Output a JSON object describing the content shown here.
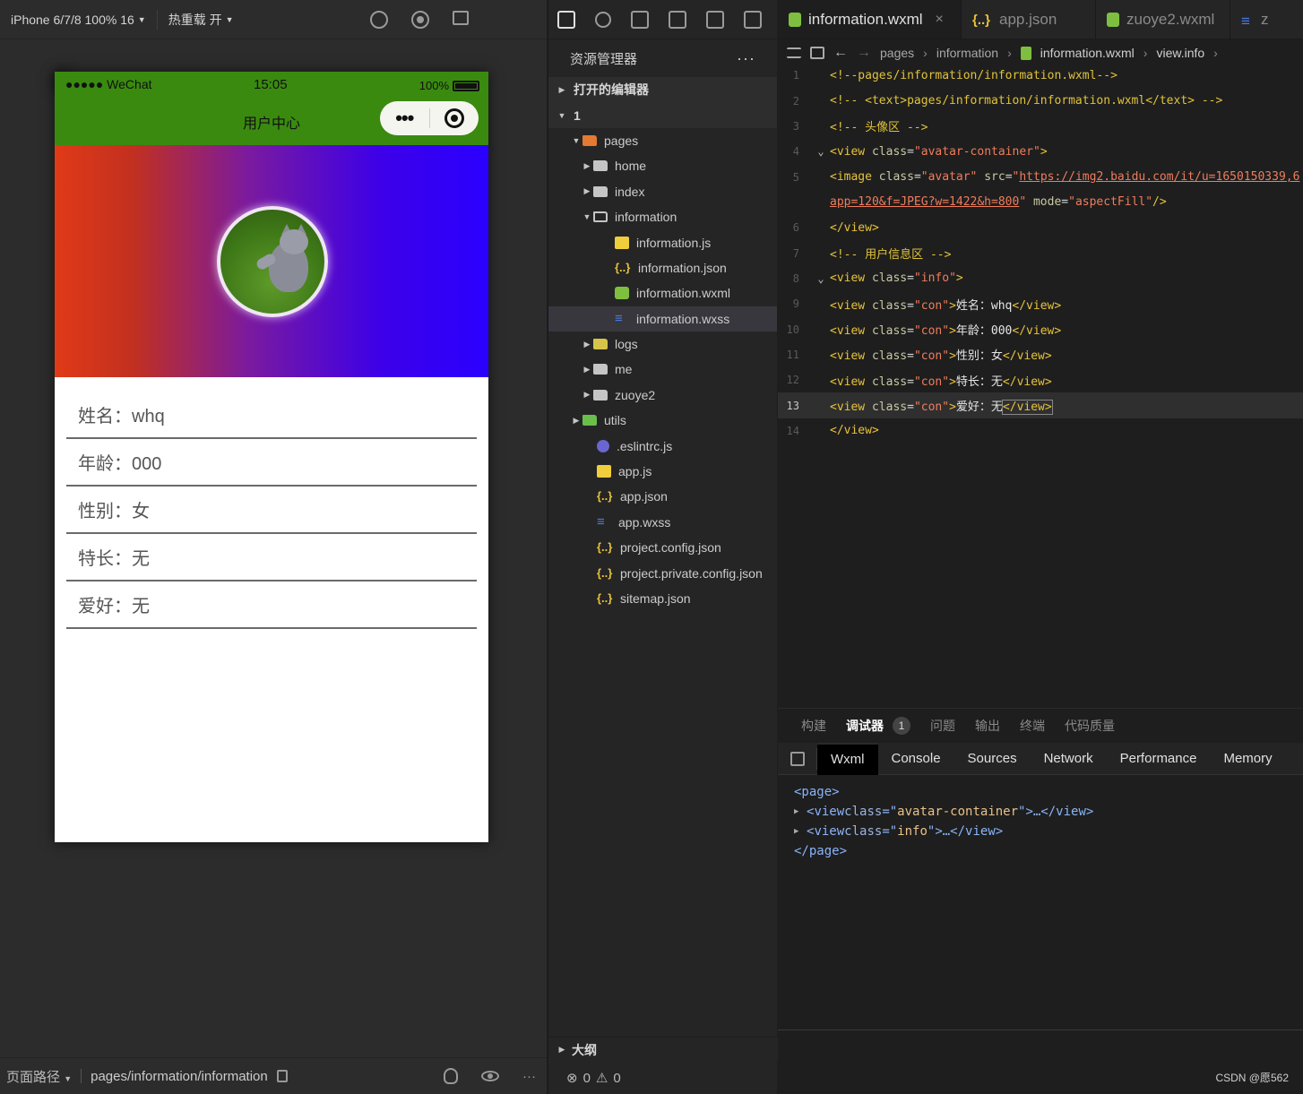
{
  "simulator": {
    "device_label": "iPhone 6/7/8 100% 16",
    "hot_reload_label": "热重载 开",
    "phone": {
      "carrier": "●●●●● WeChat",
      "time": "15:05",
      "battery": "100%",
      "nav_title": "用户中心",
      "capsule_more": "•••",
      "info_rows": [
        "姓名：whq",
        "年龄：000",
        "性别：女",
        "特长：无",
        "爱好：无"
      ]
    },
    "footer": {
      "path_label": "页面路径",
      "path_value": "pages/information/information",
      "more": "···"
    }
  },
  "explorer": {
    "title": "资源管理器",
    "more": "···",
    "tree": [
      {
        "label": "打开的编辑器",
        "type": "section",
        "arrow": "▶",
        "indent": 8
      },
      {
        "label": "1",
        "type": "section",
        "arrow": "▼",
        "indent": 8
      },
      {
        "label": "pages",
        "type": "folder-pages",
        "arrow": "▼",
        "indent": 24
      },
      {
        "label": "home",
        "type": "folder",
        "arrow": "▶",
        "indent": 36
      },
      {
        "label": "index",
        "type": "folder",
        "arrow": "▶",
        "indent": 36
      },
      {
        "label": "information",
        "type": "folder-open",
        "arrow": "▼",
        "indent": 36
      },
      {
        "label": "information.js",
        "type": "js",
        "arrow": "",
        "indent": 60
      },
      {
        "label": "information.json",
        "type": "json",
        "arrow": "",
        "indent": 60
      },
      {
        "label": "information.wxml",
        "type": "wxml",
        "arrow": "",
        "indent": 60
      },
      {
        "label": "information.wxss",
        "type": "wxss",
        "arrow": "",
        "indent": 60,
        "selected": true
      },
      {
        "label": "logs",
        "type": "folder-logs",
        "arrow": "▶",
        "indent": 36
      },
      {
        "label": "me",
        "type": "folder",
        "arrow": "▶",
        "indent": 36
      },
      {
        "label": "zuoye2",
        "type": "folder",
        "arrow": "▶",
        "indent": 36
      },
      {
        "label": "utils",
        "type": "folder-utils",
        "arrow": "▶",
        "indent": 24
      },
      {
        "label": ".eslintrc.js",
        "type": "eslint",
        "arrow": "",
        "indent": 40
      },
      {
        "label": "app.js",
        "type": "js",
        "arrow": "",
        "indent": 40
      },
      {
        "label": "app.json",
        "type": "json",
        "arrow": "",
        "indent": 40
      },
      {
        "label": "app.wxss",
        "type": "wxss",
        "arrow": "",
        "indent": 40
      },
      {
        "label": "project.config.json",
        "type": "json",
        "arrow": "",
        "indent": 40
      },
      {
        "label": "project.private.config.json",
        "type": "json",
        "arrow": "",
        "indent": 40
      },
      {
        "label": "sitemap.json",
        "type": "json",
        "arrow": "",
        "indent": 40
      }
    ],
    "outline_label": "大纲",
    "status_errors": "0",
    "status_warnings": "0"
  },
  "editor": {
    "tabs": [
      {
        "label": "information.wxml",
        "icon": "wxml",
        "active": true
      },
      {
        "label": "app.json",
        "icon": "json",
        "active": false
      },
      {
        "label": "zuoye2.wxml",
        "icon": "wxml",
        "active": false
      },
      {
        "label": "z",
        "icon": "wxss",
        "active": false
      }
    ],
    "breadcrumb": [
      "pages",
      "information",
      "information.wxml",
      "view.info"
    ],
    "current_line": 13,
    "lines": [
      {
        "n": "1",
        "fold": "",
        "html": "<span class='c-cmt'>&lt;!--pages/information/information.wxml--&gt;</span>"
      },
      {
        "n": "2",
        "fold": "",
        "html": "<span class='c-cmt'>&lt;!-- &lt;text&gt;pages/information/information.wxml&lt;/text&gt; --&gt;</span>"
      },
      {
        "n": "3",
        "fold": "",
        "html": "<span class='c-cmt'>&lt;!-- 头像区 --&gt;</span>"
      },
      {
        "n": "4",
        "fold": "⌄",
        "html": "<span class='c-tag'>&lt;view</span> <span class='c-attr'>class</span>=<span class='c-str'>\"avatar-container\"</span><span class='c-tag'>&gt;</span>"
      },
      {
        "n": "5",
        "fold": "",
        "html": "<span class='c-tag'>&lt;image</span> <span class='c-attr'>class</span>=<span class='c-str'>\"avatar\"</span> <span class='c-attr'>src</span>=<span class='c-str'>\"</span><span class='c-url'>https://img2.baidu.com/it/u=1650150339,6</span>"
      },
      {
        "n": "",
        "fold": "",
        "html": "<span class='c-url'>app=120&amp;f=JPEG?w=1422&amp;h=800</span><span class='c-str'>\"</span> <span class='c-attr'>mode</span>=<span class='c-str'>\"aspectFill\"</span><span class='c-tag'>/&gt;</span>"
      },
      {
        "n": "6",
        "fold": "",
        "html": "<span class='c-tag'>&lt;/view&gt;</span>"
      },
      {
        "n": "7",
        "fold": "",
        "html": "<span class='c-cmt'>&lt;!-- 用户信息区 --&gt;</span>"
      },
      {
        "n": "8",
        "fold": "⌄",
        "html": "<span class='c-tag'>&lt;view</span> <span class='c-attr'>class</span>=<span class='c-str'>\"info\"</span><span class='c-tag'>&gt;</span>"
      },
      {
        "n": "9",
        "fold": "",
        "html": "<span class='c-tag'>&lt;view</span> <span class='c-attr'>class</span>=<span class='c-str'>\"con\"</span><span class='c-tag'>&gt;</span><span class='c-txt'>姓名：whq</span><span class='c-tag'>&lt;/view&gt;</span>"
      },
      {
        "n": "10",
        "fold": "",
        "html": "<span class='c-tag'>&lt;view</span> <span class='c-attr'>class</span>=<span class='c-str'>\"con\"</span><span class='c-tag'>&gt;</span><span class='c-txt'>年龄：000</span><span class='c-tag'>&lt;/view&gt;</span>"
      },
      {
        "n": "11",
        "fold": "",
        "html": "<span class='c-tag'>&lt;view</span> <span class='c-attr'>class</span>=<span class='c-str'>\"con\"</span><span class='c-tag'>&gt;</span><span class='c-txt'>性别：女</span><span class='c-tag'>&lt;/view&gt;</span>"
      },
      {
        "n": "12",
        "fold": "",
        "html": "<span class='c-tag'>&lt;view</span> <span class='c-attr'>class</span>=<span class='c-str'>\"con\"</span><span class='c-tag'>&gt;</span><span class='c-txt'>特长：无</span><span class='c-tag'>&lt;/view&gt;</span>"
      },
      {
        "n": "13",
        "fold": "",
        "html": "<span class='c-tag'>&lt;view</span> <span class='c-attr'>class</span>=<span class='c-str'>\"con\"</span><span class='c-tag'>&gt;</span><span class='c-txt'>爱好：无</span><span class='c-tag' style='outline:1px solid #888'>&lt;/view&gt;</span>"
      },
      {
        "n": "14",
        "fold": "",
        "html": "<span class='c-tag'>&lt;/view&gt;</span>"
      }
    ]
  },
  "debug": {
    "panel_tabs": [
      "构建",
      "调试器",
      "问题",
      "输出",
      "终端",
      "代码质量"
    ],
    "active_panel_tab": "调试器",
    "debugger_badge": "1",
    "devtools_tabs": [
      "Wxml",
      "Console",
      "Sources",
      "Network",
      "Performance",
      "Memory"
    ],
    "active_devtools_tab": "Wxml",
    "dom": {
      "open": "<page>",
      "close": "</page>",
      "children": [
        {
          "tag": "view",
          "class_attr": "avatar-container"
        },
        {
          "tag": "view",
          "class_attr": "info"
        }
      ]
    }
  },
  "watermark": "CSDN @愿562"
}
